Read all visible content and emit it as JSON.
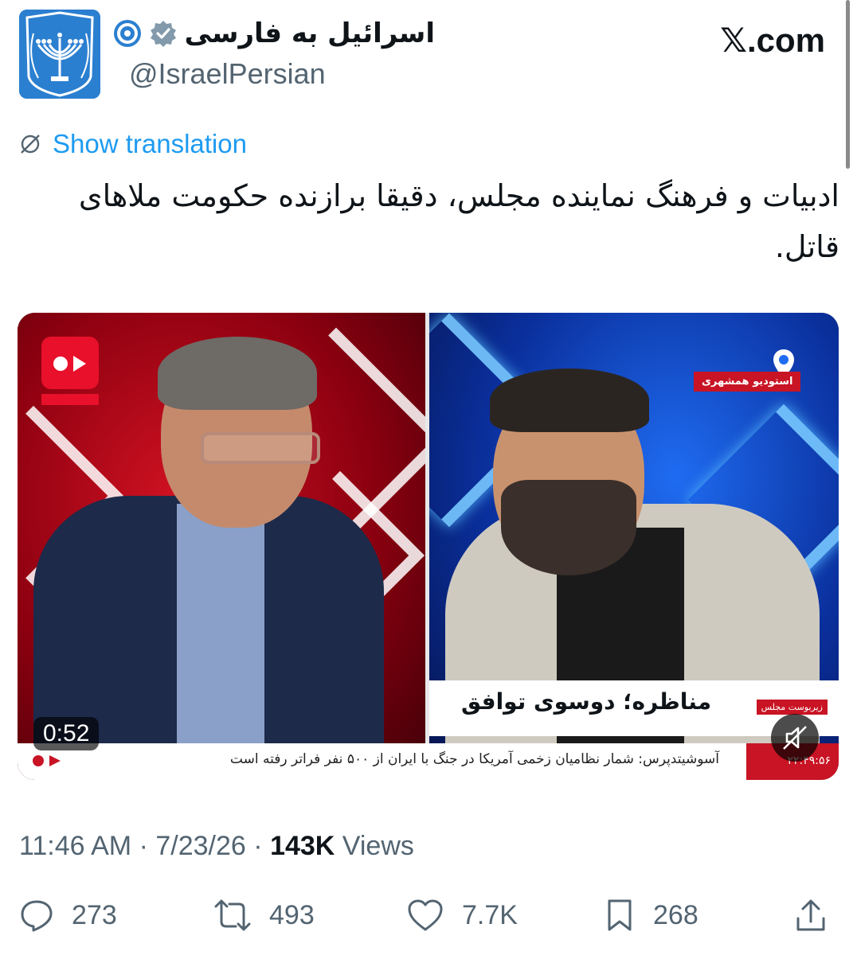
{
  "brand": "𝕏.com",
  "author": {
    "display_name": "اسرائیل به فارسی",
    "handle": "@IsraelPersian"
  },
  "show_translation": "Show translation",
  "tweet_text": "ادبیات و فرهنگ نماینده مجلس، دقیقا برازنده حکومت ملاهای قاتل.",
  "media": {
    "location_tag": "استودیو همشهری",
    "lower_third_title": "مناظره؛ دوسوی توافق",
    "lower_third_sub": "زیربوست مجلس",
    "ticker": "آسوشیتدپرس: شمار نظامیان زخمی آمریکا در جنگ با ایران از ۵۰۰ نفر فراتر رفته است",
    "ticker_clock": "۲۲:۴۹:۵۶",
    "duration": "0:52"
  },
  "meta": {
    "time": "11:46 AM",
    "date": "7/23/26",
    "views_count": "143K",
    "views_label": "Views",
    "separator": "·"
  },
  "actions": {
    "replies": "273",
    "reposts": "493",
    "likes": "7.7K",
    "bookmarks": "268"
  },
  "colors": {
    "link": "#1d9bf0",
    "muted": "#536471",
    "text": "#0f1419",
    "news_red": "#c81424"
  }
}
